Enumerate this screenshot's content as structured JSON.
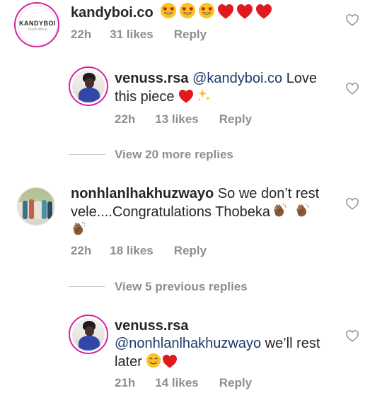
{
  "comments": [
    {
      "username": "kandyboi.co",
      "avatar_text": "KANDYBOI",
      "avatar_sub": "South Africa",
      "time": "22h",
      "likes": "31 likes",
      "reply": "Reply"
    },
    {
      "username": "venuss.rsa",
      "mention": "@kandyboi.co",
      "text": "Love",
      "text2": "this piece",
      "time": "22h",
      "likes": "13 likes",
      "reply": "Reply"
    },
    {
      "username": "nonhlanlhakhuzwayo",
      "text": "So we don’t rest",
      "text2": "vele....Congratulations Thobeka",
      "time": "22h",
      "likes": "18 likes",
      "reply": "Reply"
    },
    {
      "username": "venuss.rsa",
      "mention": "@nonhlanlhakhuzwayo",
      "text": "we’ll rest",
      "text2": "later",
      "time": "21h",
      "likes": "14 likes",
      "reply": "Reply"
    }
  ],
  "view_more_replies": "View 20 more replies",
  "view_previous_replies": "View 5 previous replies",
  "colors": {
    "accent_ring": "#d6249f",
    "heart_red": "#e0191f",
    "meta_gray": "#8e8e8e",
    "mention_blue": "#1b3a6b"
  },
  "icons": [
    "heart-outline-icon",
    "smiling-heart-eyes-emoji",
    "red-heart-emoji",
    "sparkles-emoji",
    "clapping-hands-emoji",
    "smiling-face-emoji"
  ]
}
